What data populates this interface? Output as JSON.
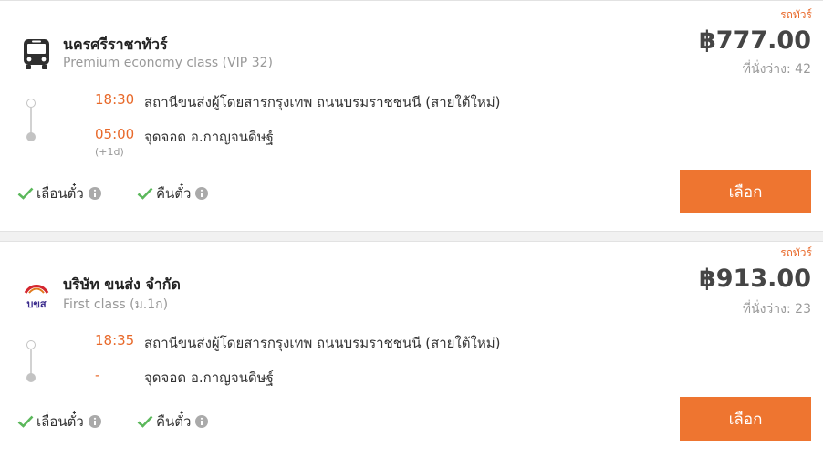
{
  "trips": [
    {
      "type_tag": "รถทัวร์",
      "operator": "นครศรีราชาทัวร์",
      "bus_class": "Premium economy class (VIP 32)",
      "price": "฿777.00",
      "seats_label": "ที่นั่งว่าง:",
      "seats_value": "42",
      "departure_time": "18:30",
      "departure_place": "สถานีขนส่งผู้โดยสารกรุงเทพ ถนนบรมราชชนนี (สายใต้ใหม่)",
      "arrival_time": "05:00",
      "arrival_day_offset": "(+1d)",
      "arrival_place": "จุดจอด อ.กาญจนดิษฐ์",
      "feature_1": "เลื่อนตั๋ว",
      "feature_2": "คืนตั๋ว",
      "select_label": "เลือก",
      "operator_icon": "bus-icon"
    },
    {
      "type_tag": "รถทัวร์",
      "operator": "บริษัท ขนส่ง จำกัด",
      "bus_class": "First class (ม.1ก)",
      "price": "฿913.00",
      "seats_label": "ที่นั่งว่าง:",
      "seats_value": "23",
      "departure_time": "18:35",
      "departure_place": "สถานีขนส่งผู้โดยสารกรุงเทพ ถนนบรมราชชนนี (สายใต้ใหม่)",
      "arrival_time": "-",
      "arrival_place": "จุดจอด อ.กาญจนดิษฐ์",
      "feature_1": "เลื่อนตั๋ว",
      "feature_2": "คืนตั๋ว",
      "select_label": "เลือก",
      "operator_icon": "transport-co-logo",
      "logo_text": "บขส"
    }
  ],
  "colors": {
    "accent": "#ee7530",
    "time": "#e8692a",
    "check": "#5cb85c"
  }
}
